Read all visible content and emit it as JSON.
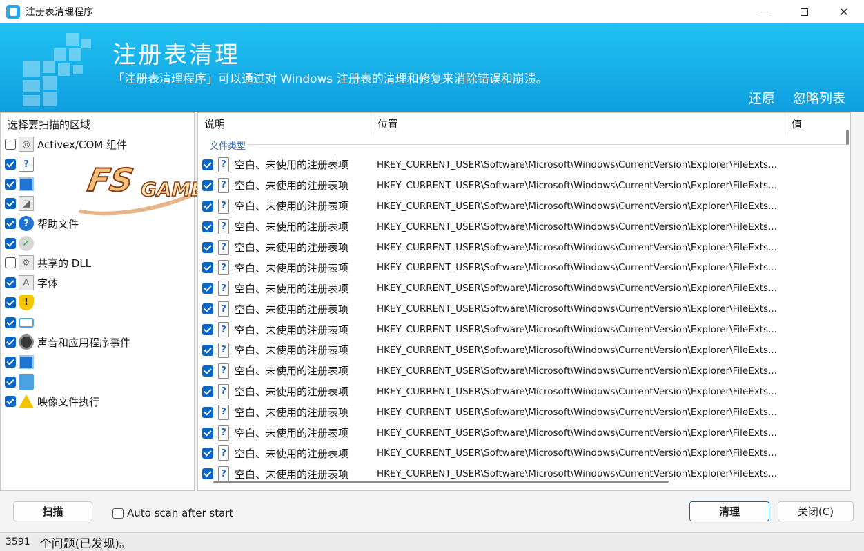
{
  "window": {
    "title": "注册表清理程序",
    "controls": {
      "minimize": "—",
      "maximize": "□",
      "close": "✕"
    }
  },
  "banner": {
    "title": "注册表清理",
    "description": "「注册表清理程序」可以通过对 Windows 注册表的清理和修复来消除错误和崩溃。",
    "links": {
      "restore": "还原",
      "ignore_list": "忽略列表"
    }
  },
  "left_panel": {
    "header": "选择要扫描的区域",
    "items": [
      {
        "label": "Activex/COM 组件",
        "checked": false,
        "icon": "activex-icon"
      },
      {
        "label": "",
        "checked": true,
        "icon": "question-doc-icon"
      },
      {
        "label": "",
        "checked": true,
        "icon": "blue-window-icon"
      },
      {
        "label": "",
        "checked": true,
        "icon": "window-gear-icon"
      },
      {
        "label": "帮助文件",
        "checked": true,
        "icon": "help-icon"
      },
      {
        "label": "",
        "checked": true,
        "icon": "green-arrow-icon"
      },
      {
        "label": "共享的 DLL",
        "checked": false,
        "icon": "dll-icon"
      },
      {
        "label": "字体",
        "checked": true,
        "icon": "font-icon"
      },
      {
        "label": "",
        "checked": true,
        "icon": "shield-warning-icon"
      },
      {
        "label": "",
        "checked": true,
        "icon": "screen-icon"
      },
      {
        "label": "声音和应用程序事件",
        "checked": true,
        "icon": "speaker-icon"
      },
      {
        "label": "",
        "checked": true,
        "icon": "window-list-icon"
      },
      {
        "label": "",
        "checked": true,
        "icon": "network-icon"
      },
      {
        "label": "映像文件执行",
        "checked": true,
        "icon": "warning-icon"
      }
    ]
  },
  "watermark": {
    "text": "FS",
    "subtext": "GAMEO"
  },
  "results": {
    "columns": {
      "description": "说明",
      "location": "位置",
      "value": "值"
    },
    "group": "文件类型",
    "rows": [
      {
        "desc": "空白、未使用的注册表项",
        "location": "HKEY_CURRENT_USER\\Software\\Microsoft\\Windows\\CurrentVersion\\Explorer\\FileExts..."
      },
      {
        "desc": "空白、未使用的注册表项",
        "location": "HKEY_CURRENT_USER\\Software\\Microsoft\\Windows\\CurrentVersion\\Explorer\\FileExts..."
      },
      {
        "desc": "空白、未使用的注册表项",
        "location": "HKEY_CURRENT_USER\\Software\\Microsoft\\Windows\\CurrentVersion\\Explorer\\FileExts..."
      },
      {
        "desc": "空白、未使用的注册表项",
        "location": "HKEY_CURRENT_USER\\Software\\Microsoft\\Windows\\CurrentVersion\\Explorer\\FileExts..."
      },
      {
        "desc": "空白、未使用的注册表项",
        "location": "HKEY_CURRENT_USER\\Software\\Microsoft\\Windows\\CurrentVersion\\Explorer\\FileExts..."
      },
      {
        "desc": "空白、未使用的注册表项",
        "location": "HKEY_CURRENT_USER\\Software\\Microsoft\\Windows\\CurrentVersion\\Explorer\\FileExts..."
      },
      {
        "desc": "空白、未使用的注册表项",
        "location": "HKEY_CURRENT_USER\\Software\\Microsoft\\Windows\\CurrentVersion\\Explorer\\FileExts..."
      },
      {
        "desc": "空白、未使用的注册表项",
        "location": "HKEY_CURRENT_USER\\Software\\Microsoft\\Windows\\CurrentVersion\\Explorer\\FileExts..."
      },
      {
        "desc": "空白、未使用的注册表项",
        "location": "HKEY_CURRENT_USER\\Software\\Microsoft\\Windows\\CurrentVersion\\Explorer\\FileExts..."
      },
      {
        "desc": "空白、未使用的注册表项",
        "location": "HKEY_CURRENT_USER\\Software\\Microsoft\\Windows\\CurrentVersion\\Explorer\\FileExts..."
      },
      {
        "desc": "空白、未使用的注册表项",
        "location": "HKEY_CURRENT_USER\\Software\\Microsoft\\Windows\\CurrentVersion\\Explorer\\FileExts..."
      },
      {
        "desc": "空白、未使用的注册表项",
        "location": "HKEY_CURRENT_USER\\Software\\Microsoft\\Windows\\CurrentVersion\\Explorer\\FileExts..."
      },
      {
        "desc": "空白、未使用的注册表项",
        "location": "HKEY_CURRENT_USER\\Software\\Microsoft\\Windows\\CurrentVersion\\Explorer\\FileExts..."
      },
      {
        "desc": "空白、未使用的注册表项",
        "location": "HKEY_CURRENT_USER\\Software\\Microsoft\\Windows\\CurrentVersion\\Explorer\\FileExts..."
      },
      {
        "desc": "空白、未使用的注册表项",
        "location": "HKEY_CURRENT_USER\\Software\\Microsoft\\Windows\\CurrentVersion\\Explorer\\FileExts..."
      },
      {
        "desc": "空白、未使用的注册表项",
        "location": "HKEY_CURRENT_USER\\Software\\Microsoft\\Windows\\CurrentVersion\\Explorer\\FileExts..."
      }
    ]
  },
  "toolbar": {
    "scan": "扫描",
    "auto_scan": "Auto scan after start",
    "auto_scan_checked": false,
    "clean": "清理",
    "close": "关闭(C)"
  },
  "status": {
    "count": "3591",
    "text": "个问题(已发现)。"
  },
  "colors": {
    "accent": "#0a66c4",
    "banner": "#16aee8",
    "link": "#3a6fb5"
  }
}
